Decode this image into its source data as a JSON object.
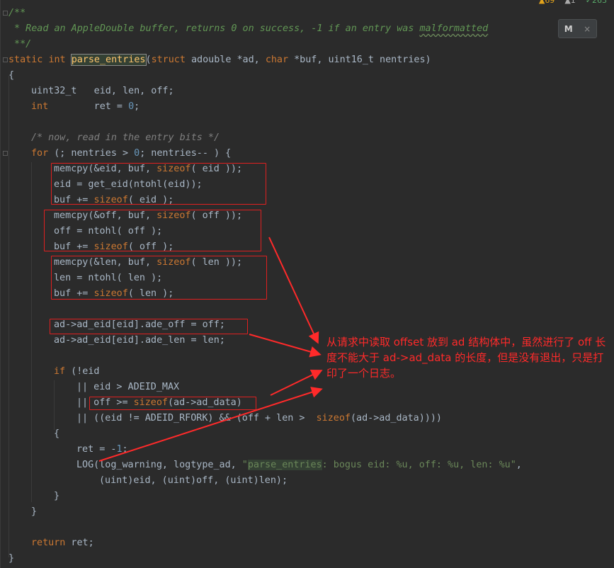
{
  "status": {
    "warnings": "69",
    "weak_warnings": "1",
    "typos": "263"
  },
  "popup": {
    "label": "M",
    "close": "×"
  },
  "code": {
    "l1": "/**",
    "l2": " * Read an AppleDouble buffer, returns 0 on success, -1 if an entry was ",
    "l2b": "malformatted",
    "l3": " **/",
    "l4_static": "static",
    "l4_int": "int",
    "l4_fn": "parse_entries",
    "l4_open": "(",
    "l4_struct": "struct",
    "l4_a": " adouble *ad, ",
    "l4_char": "char",
    "l4_b": " *buf, uint16_t nentries)",
    "l5": "{",
    "l6": "uint32_t   eid, len, off;",
    "l7_int": "int",
    "l7_rest": "        ret = ",
    "l7_zero": "0",
    "l7_end": ";",
    "l8": "/* now, read in the entry bits */",
    "l9_for": "for",
    "l9_a": " (; nentries > ",
    "l9_zero": "0",
    "l9_b": "; nentries-- ) {",
    "l10_a": "memcpy(&eid, buf, ",
    "l10_sz": "sizeof",
    "l10_b": "( eid ));",
    "l11": "eid = get_eid(ntohl(eid));",
    "l12_a": "buf += ",
    "l12_sz": "sizeof",
    "l12_b": "( eid );",
    "l13_a": "memcpy(&off, buf, ",
    "l13_sz": "sizeof",
    "l13_b": "( off ));",
    "l14": "off = ntohl( off );",
    "l15_a": "buf += ",
    "l15_sz": "sizeof",
    "l15_b": "( off );",
    "l16_a": "memcpy(&len, buf, ",
    "l16_sz": "sizeof",
    "l16_b": "( len ));",
    "l17": "len = ntohl( len );",
    "l18_a": "buf += ",
    "l18_sz": "sizeof",
    "l18_b": "( len );",
    "l19": "ad->ad_eid[eid].ade_off = off;",
    "l20": "ad->ad_eid[eid].ade_len = len;",
    "l21_if": "if",
    "l21_b": " (!eid",
    "l22": "|| eid > ADEID_MAX",
    "l23_a": "|| off >= ",
    "l23_sz": "sizeof",
    "l23_b": "(ad->ad_data)",
    "l24_a": "|| ((eid != ADEID_RFORK) && (off + len >  ",
    "l24_sz": "sizeof",
    "l24_b": "(ad->ad_data))))",
    "l25": "{",
    "l26_a": "ret = -",
    "l26_num": "1",
    "l26_b": ";",
    "l27_a": "LOG(log_warning, logtype_ad, ",
    "l27_q": "\"",
    "l27_hl": "parse_entries",
    "l27_s": ": bogus eid: %u, off: %u, len: %u\"",
    "l27_b": ",",
    "l28": "(uint)eid, (uint)off, (uint)len);",
    "l29": "}",
    "l30": "}",
    "l31_ret": "return",
    "l31_b": " ret;",
    "l32": "}"
  },
  "annotation": "从请求中读取 offset 放到 ad 结构体中，虽然进行了 off 长度不能大于 ad->ad_data 的长度，但是没有退出，只是打印了一个日志。",
  "colors": {
    "highlight_box": "#e02020",
    "annotation": "#ff2a2a",
    "background": "#2b2b2b"
  }
}
